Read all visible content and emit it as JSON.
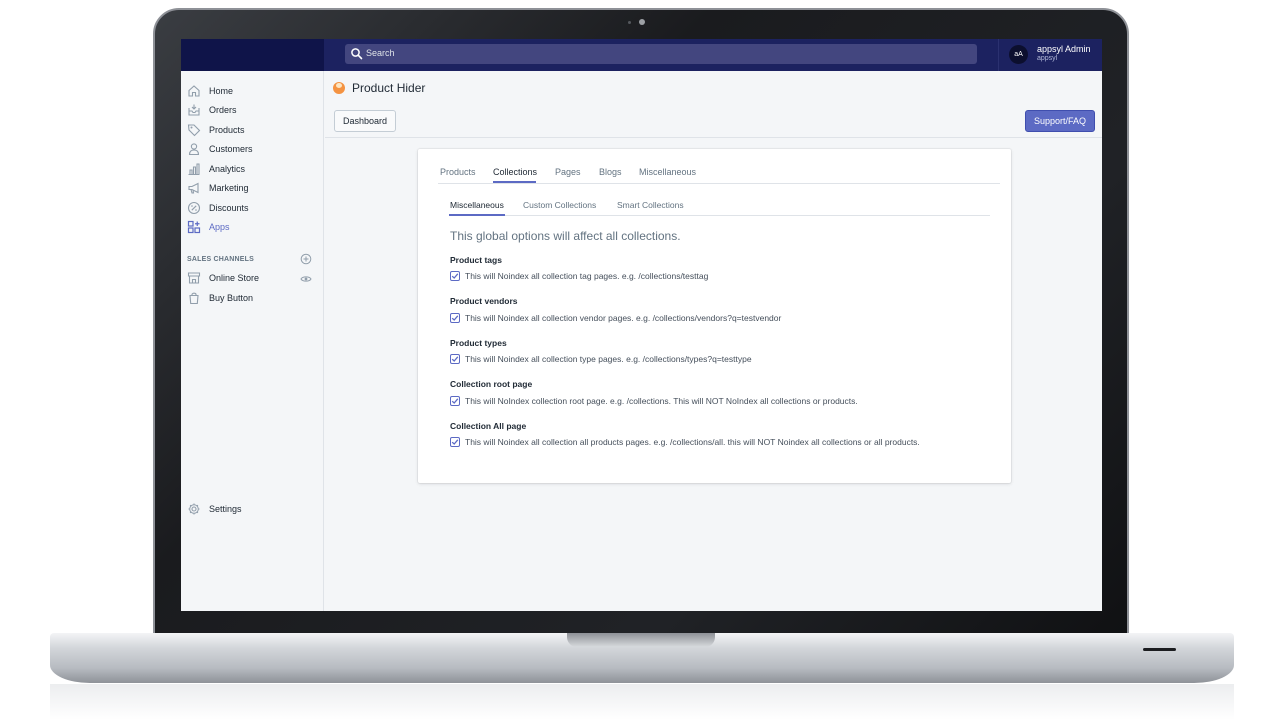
{
  "topbar": {
    "search_placeholder": "Search",
    "user_initials": "aA",
    "user_name": "appsyl Admin",
    "store_name": "appsyl"
  },
  "sidebar": {
    "items": [
      {
        "label": "Home",
        "icon": "home-icon"
      },
      {
        "label": "Orders",
        "icon": "orders-icon"
      },
      {
        "label": "Products",
        "icon": "tag-icon"
      },
      {
        "label": "Customers",
        "icon": "person-icon"
      },
      {
        "label": "Analytics",
        "icon": "bar-chart-icon"
      },
      {
        "label": "Marketing",
        "icon": "megaphone-icon"
      },
      {
        "label": "Discounts",
        "icon": "discount-icon"
      },
      {
        "label": "Apps",
        "icon": "apps-icon",
        "active": true
      }
    ],
    "sales_channels_heading": "SALES CHANNELS",
    "channels": [
      {
        "label": "Online Store",
        "icon": "store-icon"
      },
      {
        "label": "Buy Button",
        "icon": "buy-button-icon"
      }
    ],
    "settings_label": "Settings"
  },
  "header": {
    "app_title": "Product Hider",
    "dashboard_button": "Dashboard",
    "support_button": "Support/FAQ"
  },
  "tabs": [
    "Products",
    "Collections",
    "Pages",
    "Blogs",
    "Miscellaneous"
  ],
  "active_tab": "Collections",
  "subtabs": [
    "Miscellaneous",
    "Custom Collections",
    "Smart Collections"
  ],
  "active_subtab": "Miscellaneous",
  "intro_text": "This global options will affect all collections.",
  "options": [
    {
      "title": "Product tags",
      "description": "This will Noindex all collection tag pages. e.g. /collections/testtag",
      "checked": true
    },
    {
      "title": "Product vendors",
      "description": "This will Noindex all collection vendor pages. e.g. /collections/vendors?q=testvendor",
      "checked": true
    },
    {
      "title": "Product types",
      "description": "This will Noindex all collection type pages. e.g. /collections/types?q=testtype",
      "checked": true
    },
    {
      "title": "Collection root page",
      "description": "This will NoIndex collection root page. e.g. /collections. This will NOT NoIndex all collections or products.",
      "checked": true
    },
    {
      "title": "Collection All page",
      "description": "This will Noindex all collection all products pages. e.g. /collections/all. this will NOT Noindex all collections or all products.",
      "checked": true
    }
  ],
  "colors": {
    "topbar": "#1c2260",
    "accent": "#5c6ac4",
    "text": "#212b36",
    "muted": "#637381"
  }
}
